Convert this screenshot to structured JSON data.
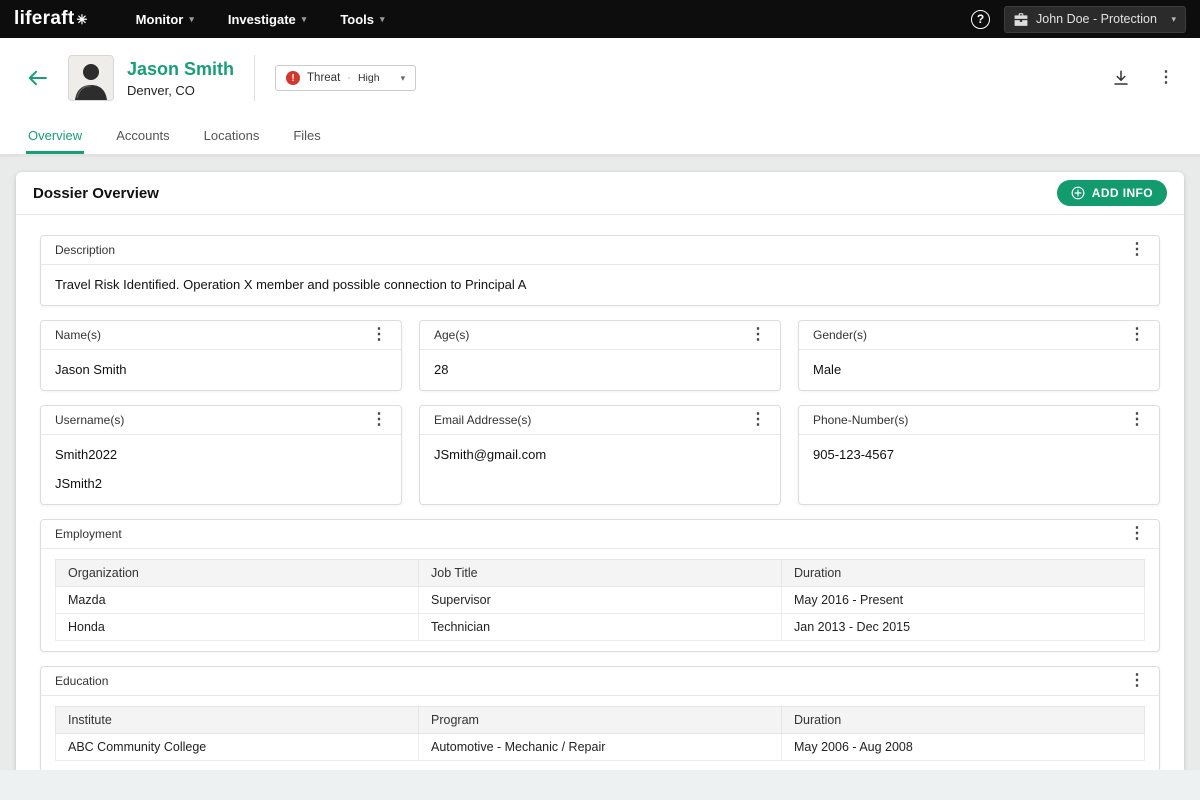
{
  "navbar": {
    "brand": "liferaft",
    "menus": [
      {
        "label": "Monitor"
      },
      {
        "label": "Investigate"
      },
      {
        "label": "Tools"
      }
    ],
    "help": "?",
    "account_label": "John Doe - Protection"
  },
  "profile_header": {
    "name": "Jason Smith",
    "location": "Denver, CO",
    "threat": {
      "label": "Threat",
      "separator": "·",
      "level": "High"
    }
  },
  "tabs": [
    {
      "label": "Overview",
      "active": true
    },
    {
      "label": "Accounts",
      "active": false
    },
    {
      "label": "Locations",
      "active": false
    },
    {
      "label": "Files",
      "active": false
    }
  ],
  "dossier": {
    "title": "Dossier Overview",
    "add_info_label": "ADD INFO",
    "description": {
      "label": "Description",
      "value": "Travel Risk Identified. Operation X member and possible connection to Principal A"
    },
    "fields": [
      {
        "label": "Name(s)",
        "values": [
          "Jason Smith"
        ]
      },
      {
        "label": "Age(s)",
        "values": [
          "28"
        ]
      },
      {
        "label": "Gender(s)",
        "values": [
          "Male"
        ]
      },
      {
        "label": "Username(s)",
        "values": [
          "Smith2022",
          "JSmith2"
        ]
      },
      {
        "label": "Email Addresse(s)",
        "values": [
          "JSmith@gmail.com"
        ]
      },
      {
        "label": "Phone-Number(s)",
        "values": [
          "905-123-4567"
        ]
      }
    ],
    "employment": {
      "label": "Employment",
      "columns": [
        "Organization",
        "Job Title",
        "Duration"
      ],
      "rows": [
        [
          "Mazda",
          "Supervisor",
          "May 2016 - Present"
        ],
        [
          "Honda",
          "Technician",
          "Jan 2013 - Dec 2015"
        ]
      ]
    },
    "education": {
      "label": "Education",
      "columns": [
        "Institute",
        "Program",
        "Duration"
      ],
      "rows": [
        [
          "ABC Community College",
          "Automotive - Mechanic / Repair",
          "May 2006 - Aug 2008"
        ]
      ]
    }
  },
  "icons": {
    "logo_star": "✳",
    "chevron_down": "▾",
    "kebab": "⋮",
    "alert": "!"
  },
  "colors": {
    "accent": "#17a077",
    "button_green": "#129b6d",
    "danger": "#d4372c",
    "navbar_bg": "#0d0d0d",
    "page_bg": "#e9eaea"
  }
}
